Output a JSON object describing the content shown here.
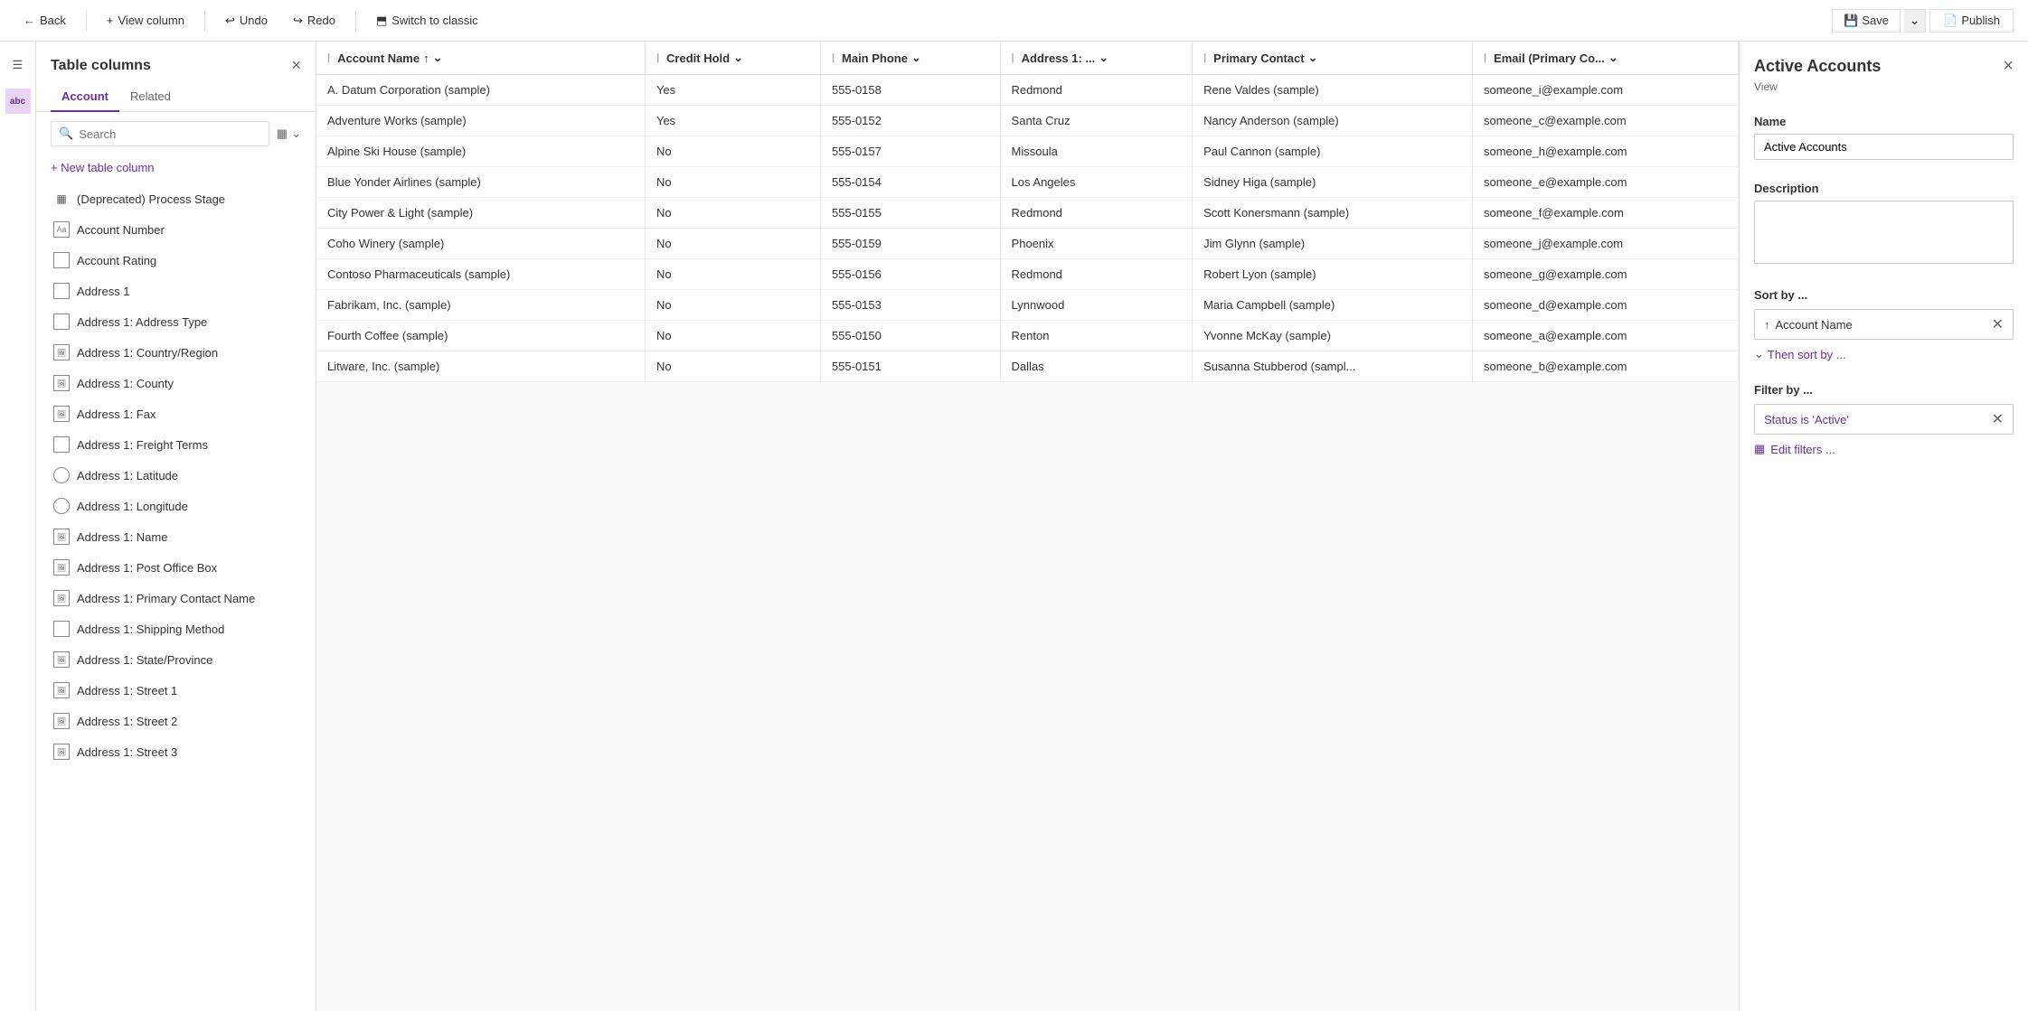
{
  "toolbar": {
    "back_label": "Back",
    "view_column_label": "View column",
    "undo_label": "Undo",
    "redo_label": "Redo",
    "switch_classic_label": "Switch to classic",
    "save_label": "Save",
    "publish_label": "Publish"
  },
  "left_panel": {
    "title": "Table columns",
    "close_label": "×",
    "tabs": [
      {
        "id": "account",
        "label": "Account",
        "active": true
      },
      {
        "id": "related",
        "label": "Related",
        "active": false
      }
    ],
    "search_placeholder": "Search",
    "new_column_label": "+ New table column",
    "columns": [
      {
        "id": "deprecated-process",
        "icon": "grid",
        "label": "(Deprecated) Process Stage"
      },
      {
        "id": "account-number",
        "icon": "text",
        "label": "Account Number"
      },
      {
        "id": "account-rating",
        "icon": "box",
        "label": "Account Rating"
      },
      {
        "id": "address1",
        "icon": "box",
        "label": "Address 1"
      },
      {
        "id": "address1-type",
        "icon": "box",
        "label": "Address 1: Address Type"
      },
      {
        "id": "address1-country",
        "icon": "img",
        "label": "Address 1: Country/Region"
      },
      {
        "id": "address1-county",
        "icon": "img",
        "label": "Address 1: County"
      },
      {
        "id": "address1-fax",
        "icon": "img",
        "label": "Address 1: Fax"
      },
      {
        "id": "address1-freight",
        "icon": "box",
        "label": "Address 1: Freight Terms"
      },
      {
        "id": "address1-latitude",
        "icon": "circle",
        "label": "Address 1: Latitude"
      },
      {
        "id": "address1-longitude",
        "icon": "circle",
        "label": "Address 1: Longitude"
      },
      {
        "id": "address1-name",
        "icon": "img",
        "label": "Address 1: Name"
      },
      {
        "id": "address1-pobox",
        "icon": "img",
        "label": "Address 1: Post Office Box"
      },
      {
        "id": "address1-primary-contact",
        "icon": "img",
        "label": "Address 1: Primary Contact Name"
      },
      {
        "id": "address1-shipping",
        "icon": "box",
        "label": "Address 1: Shipping Method"
      },
      {
        "id": "address1-state",
        "icon": "img",
        "label": "Address 1: State/Province"
      },
      {
        "id": "address1-street1",
        "icon": "img",
        "label": "Address 1: Street 1"
      },
      {
        "id": "address1-street2",
        "icon": "img",
        "label": "Address 1: Street 2"
      },
      {
        "id": "address1-street3",
        "icon": "img",
        "label": "Address 1: Street 3"
      }
    ]
  },
  "table": {
    "columns": [
      {
        "id": "account-name",
        "label": "Account Name",
        "sorted": "asc"
      },
      {
        "id": "credit-hold",
        "label": "Credit Hold",
        "sorted": null
      },
      {
        "id": "main-phone",
        "label": "Main Phone",
        "sorted": null
      },
      {
        "id": "address1",
        "label": "Address 1: ...",
        "sorted": null
      },
      {
        "id": "primary-contact",
        "label": "Primary Contact",
        "sorted": null
      },
      {
        "id": "email",
        "label": "Email (Primary Co...",
        "sorted": null
      }
    ],
    "rows": [
      {
        "account_name": "A. Datum Corporation (sample)",
        "credit_hold": "Yes",
        "main_phone": "555-0158",
        "address1": "Redmond",
        "primary_contact": "Rene Valdes (sample)",
        "email": "someone_i@example.com"
      },
      {
        "account_name": "Adventure Works (sample)",
        "credit_hold": "Yes",
        "main_phone": "555-0152",
        "address1": "Santa Cruz",
        "primary_contact": "Nancy Anderson (sample)",
        "email": "someone_c@example.com"
      },
      {
        "account_name": "Alpine Ski House (sample)",
        "credit_hold": "No",
        "main_phone": "555-0157",
        "address1": "Missoula",
        "primary_contact": "Paul Cannon (sample)",
        "email": "someone_h@example.com"
      },
      {
        "account_name": "Blue Yonder Airlines (sample)",
        "credit_hold": "No",
        "main_phone": "555-0154",
        "address1": "Los Angeles",
        "primary_contact": "Sidney Higa (sample)",
        "email": "someone_e@example.com"
      },
      {
        "account_name": "City Power & Light (sample)",
        "credit_hold": "No",
        "main_phone": "555-0155",
        "address1": "Redmond",
        "primary_contact": "Scott Konersmann (sample)",
        "email": "someone_f@example.com"
      },
      {
        "account_name": "Coho Winery (sample)",
        "credit_hold": "No",
        "main_phone": "555-0159",
        "address1": "Phoenix",
        "primary_contact": "Jim Glynn (sample)",
        "email": "someone_j@example.com"
      },
      {
        "account_name": "Contoso Pharmaceuticals (sample)",
        "credit_hold": "No",
        "main_phone": "555-0156",
        "address1": "Redmond",
        "primary_contact": "Robert Lyon (sample)",
        "email": "someone_g@example.com"
      },
      {
        "account_name": "Fabrikam, Inc. (sample)",
        "credit_hold": "No",
        "main_phone": "555-0153",
        "address1": "Lynnwood",
        "primary_contact": "Maria Campbell (sample)",
        "email": "someone_d@example.com"
      },
      {
        "account_name": "Fourth Coffee (sample)",
        "credit_hold": "No",
        "main_phone": "555-0150",
        "address1": "Renton",
        "primary_contact": "Yvonne McKay (sample)",
        "email": "someone_a@example.com"
      },
      {
        "account_name": "Litware, Inc. (sample)",
        "credit_hold": "No",
        "main_phone": "555-0151",
        "address1": "Dallas",
        "primary_contact": "Susanna Stubberod (sampl...",
        "email": "someone_b@example.com"
      }
    ]
  },
  "right_panel": {
    "title": "Active Accounts",
    "subtitle": "View",
    "close_label": "×",
    "name_label": "Name",
    "name_value": "Active Accounts",
    "name_placeholder": "Active Accounts",
    "description_label": "Description",
    "description_placeholder": "",
    "sort_title": "Sort by ...",
    "sort_item_label": "Account Name",
    "sort_direction_icon": "↑",
    "then_sort_label": "Then sort by ...",
    "filter_title": "Filter by ...",
    "filter_item_label": "Status is 'Active'",
    "edit_filters_label": "Edit filters ..."
  }
}
